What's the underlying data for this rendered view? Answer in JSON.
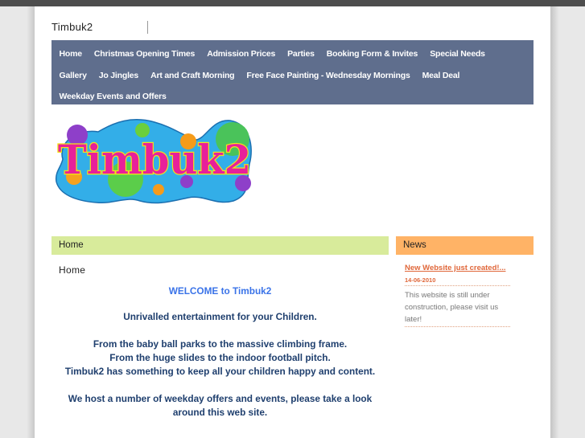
{
  "header": {
    "site_title": "Timbuk2"
  },
  "nav": {
    "rows": [
      [
        "Home",
        "Christmas Opening Times",
        "Admission Prices",
        "Parties",
        "Booking Form & Invites",
        "Special Needs"
      ],
      [
        "Gallery",
        "Jo Jingles",
        "Art and Craft Morning",
        "Free Face Painting - Wednesday Mornings",
        "Meal Deal"
      ],
      [
        "Weekday Events and Offers"
      ]
    ]
  },
  "logo": {
    "text": "Timbuk2",
    "alt": "Timbuk2 logo"
  },
  "content": {
    "heading": "Home",
    "subheading": "Home",
    "welcome": "WELCOME to Timbuk2",
    "paragraphs": [
      [
        "Unrivalled entertainment for your Children."
      ],
      [
        "From the baby ball parks to the massive climbing frame.",
        "From the huge slides to the indoor football pitch.",
        "Timbuk2 has something to keep all your children happy and content."
      ],
      [
        "We host a number of weekday offers and events, please take a look around this web site."
      ]
    ]
  },
  "news": {
    "heading": "News",
    "items": [
      {
        "title": "New Website just created!...",
        "date": "14-06-2010",
        "text": "This website is still under construction, please visit us later!"
      }
    ]
  },
  "colors": {
    "nav_bg": "#5f6e8d",
    "content_head_bg": "#d8eb9b",
    "news_head_bg": "#ffb366",
    "welcome_text": "#3a73e8",
    "body_text": "#1f3f6e",
    "news_accent": "#e0673a"
  }
}
